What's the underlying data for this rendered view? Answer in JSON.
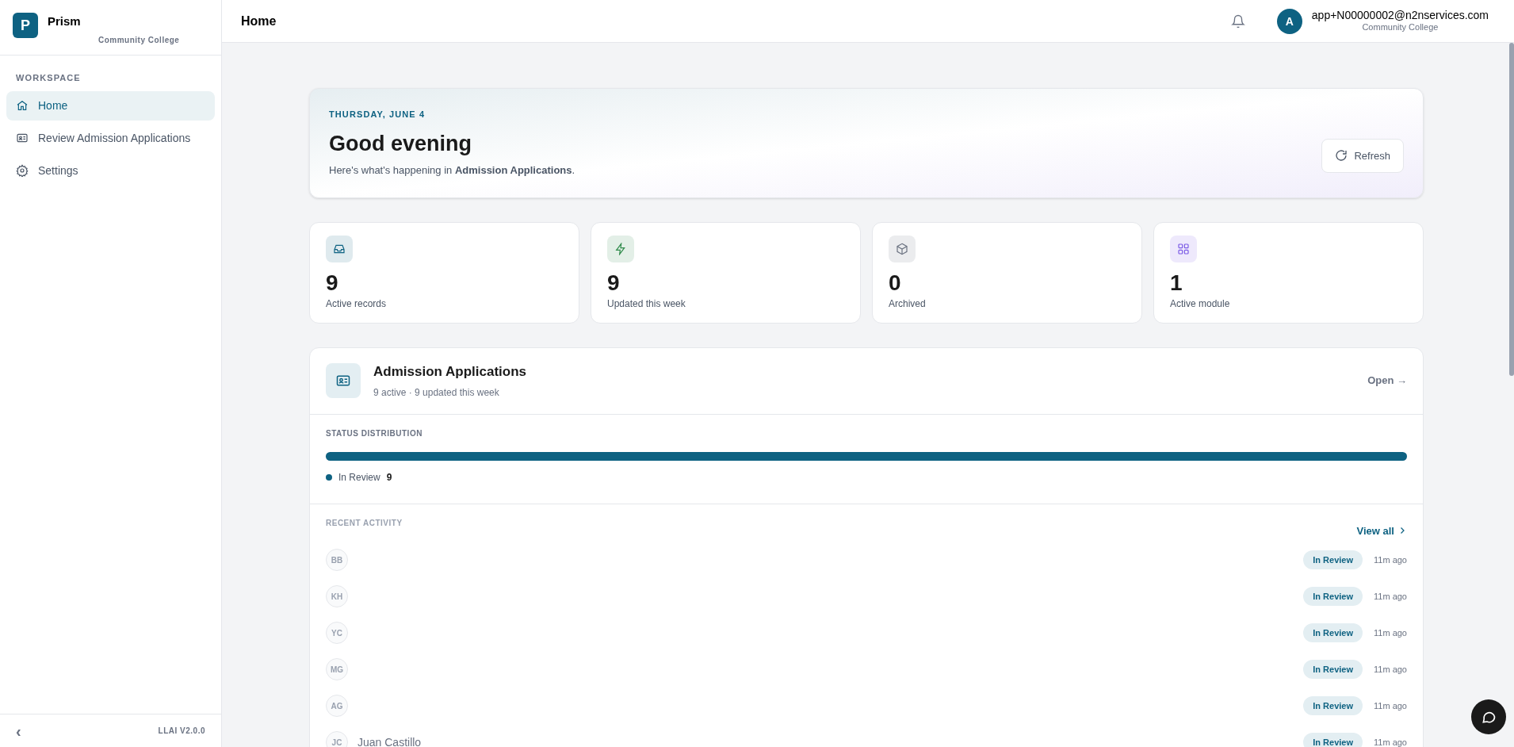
{
  "sidebar": {
    "logo_letter": "P",
    "app_name": "Prism",
    "org": "Community College",
    "section": "WORKSPACE",
    "items": [
      {
        "label": "Home",
        "kind": "home",
        "selected": true
      },
      {
        "label": "Review Admission Applications",
        "kind": "applications",
        "selected": false
      },
      {
        "label": "Settings",
        "kind": "settings",
        "selected": false
      }
    ],
    "collapse": "‹",
    "version": "LLAI V2.0.0"
  },
  "header": {
    "title": "Home",
    "user_initial": "A",
    "user_email": "app+N00000002@n2nservices.com",
    "user_org": "Community College"
  },
  "hero": {
    "date": "THURSDAY, JUNE 4",
    "greeting": "Good evening",
    "subtitle": "Here's what's happening in **Admission Applications**.",
    "refresh": "Refresh"
  },
  "stats": [
    {
      "value": "9",
      "label": "Active records",
      "kind": "records",
      "color": "#0e6282"
    },
    {
      "value": "9",
      "label": "Updated this week",
      "kind": "updated",
      "color": "#2f8a4a"
    },
    {
      "value": "0",
      "label": "Archived",
      "kind": "archived",
      "color": "#6b7280"
    },
    {
      "value": "1",
      "label": "Active module",
      "kind": "modules",
      "color": "#7c5ce6"
    }
  ],
  "module": {
    "title": "Admission Applications",
    "subtitle": "9 active · 9 updated this week",
    "open": "Open →",
    "status_heading": "STATUS DISTRIBUTION",
    "status_bar": {
      "level": 1
    },
    "legend": [
      {
        "label": "In Review",
        "count": "9",
        "color": "#0e6282"
      }
    ],
    "activity_heading": "RECENT ACTIVITY",
    "view_all": "View all",
    "rows": [
      {
        "initials": "BB",
        "status": "In Review",
        "time": "11m ago"
      },
      {
        "initials": "KH",
        "status": "In Review",
        "time": "11m ago"
      },
      {
        "initials": "YC",
        "status": "In Review",
        "time": "11m ago"
      },
      {
        "initials": "MG",
        "status": "In Review",
        "time": "11m ago"
      },
      {
        "initials": "AG",
        "status": "In Review",
        "time": "11m ago"
      },
      {
        "initials": "JC",
        "name": "Juan Castillo",
        "status": "In Review",
        "time": "11m ago"
      }
    ]
  }
}
